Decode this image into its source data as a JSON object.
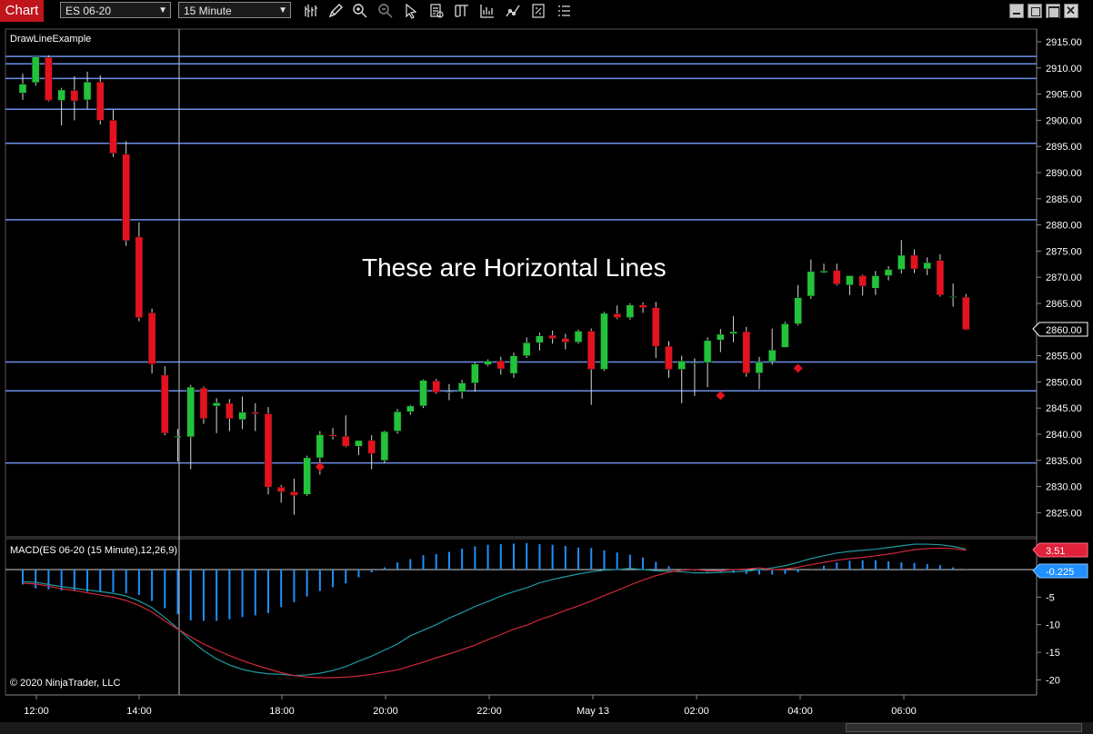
{
  "app": {
    "title": "Chart"
  },
  "toolbar": {
    "instrument": "ES 06-20",
    "interval": "15 Minute",
    "icons": [
      "bar-style-icon",
      "drawing-tools-icon",
      "zoom-in-icon",
      "zoom-out-icon",
      "pointer-icon",
      "data-box-icon",
      "properties-icon",
      "indicators-icon",
      "strategies-icon",
      "templates-icon",
      "chart-trader-icon"
    ]
  },
  "window_controls": [
    "minimize-icon",
    "restore-icon",
    "maximize-icon",
    "close-icon"
  ],
  "price_panel": {
    "label": "DrawLineExample",
    "annotation": "These are Horizontal Lines",
    "current_price": "2860.00",
    "axis_ticks": [
      "2915.00",
      "2910.00",
      "2905.00",
      "2900.00",
      "2895.00",
      "2890.00",
      "2885.00",
      "2880.00",
      "2875.00",
      "2870.00",
      "2865.00",
      "2860.00",
      "2855.00",
      "2850.00",
      "2845.00",
      "2840.00",
      "2835.00",
      "2830.00",
      "2825.00"
    ],
    "horizontal_lines": [
      2912.2,
      2910.8,
      2908.0,
      2902.1,
      2895.6,
      2881.0,
      2853.8,
      2848.3,
      2834.5
    ],
    "line_color": "#6b8fe8"
  },
  "macd_panel": {
    "label": "MACD(ES 06-20 (15 Minute),12,26,9)",
    "macd_value": "3.51",
    "signal_value": "-0.225",
    "axis_ticks": [
      "-5",
      "-10",
      "-15",
      "-20"
    ],
    "copyright": "© 2020 NinjaTrader, LLC",
    "colors": {
      "macd": "#d0283a",
      "avg": "#1f9aa0",
      "hist": "#1e90ff"
    }
  },
  "time_axis": [
    "12:00",
    "14:00",
    "18:00",
    "20:00",
    "22:00",
    "May 13",
    "02:00",
    "04:00",
    "06:00"
  ],
  "chart_data": {
    "type": "candlestick",
    "up_color": "#22c33a",
    "down_color": "#e3121e",
    "candles": [
      [
        2905.2,
        2908.9,
        2903.9,
        2906.9
      ],
      [
        2907.2,
        2912.0,
        2906.6,
        2912.1
      ],
      [
        2912.0,
        2912.4,
        2903.6,
        2903.8
      ],
      [
        2903.8,
        2906.2,
        2899.0,
        2905.8
      ],
      [
        2905.7,
        2908.4,
        2900.0,
        2903.7
      ],
      [
        2903.9,
        2909.3,
        2902.2,
        2907.3
      ],
      [
        2907.3,
        2908.6,
        2899.2,
        2900.0
      ],
      [
        2900.0,
        2902.0,
        2893.0,
        2893.7
      ],
      [
        2893.5,
        2896.0,
        2876.0,
        2877.0
      ],
      [
        2877.7,
        2880.5,
        2861.6,
        2862.3
      ],
      [
        2863.2,
        2864.0,
        2851.6,
        2853.4
      ],
      [
        2851.3,
        2853.0,
        2839.8,
        2840.2
      ],
      [
        2839.4,
        2841.0,
        2834.8,
        2839.6
      ],
      [
        2839.5,
        2849.4,
        2833.3,
        2849.0
      ],
      [
        2848.8,
        2849.1,
        2842.0,
        2843.0
      ],
      [
        2845.4,
        2846.9,
        2840.2,
        2846.0
      ],
      [
        2845.9,
        2846.7,
        2840.6,
        2843.0
      ],
      [
        2842.8,
        2847.2,
        2841.0,
        2844.2
      ],
      [
        2844.2,
        2845.9,
        2840.6,
        2843.9
      ],
      [
        2843.9,
        2845.2,
        2828.5,
        2829.9
      ],
      [
        2829.9,
        2830.3,
        2826.9,
        2829.0
      ],
      [
        2829.0,
        2831.5,
        2824.6,
        2828.3
      ],
      [
        2828.5,
        2835.9,
        2828.2,
        2835.5
      ],
      [
        2835.5,
        2840.6,
        2832.3,
        2839.9
      ],
      [
        2839.9,
        2841.2,
        2839.0,
        2839.6
      ],
      [
        2839.6,
        2843.6,
        2837.5,
        2837.7
      ],
      [
        2837.7,
        2838.8,
        2836.0,
        2838.8
      ],
      [
        2838.8,
        2839.8,
        2833.3,
        2836.3
      ],
      [
        2835.0,
        2840.7,
        2834.5,
        2840.5
      ],
      [
        2840.6,
        2844.8,
        2840.1,
        2844.3
      ],
      [
        2844.3,
        2845.6,
        2843.7,
        2845.4
      ],
      [
        2845.4,
        2850.5,
        2845.0,
        2850.3
      ],
      [
        2850.2,
        2850.6,
        2847.7,
        2848.0
      ],
      [
        2848.0,
        2849.6,
        2846.5,
        2848.1
      ],
      [
        2848.1,
        2850.4,
        2846.8,
        2849.8
      ],
      [
        2849.8,
        2853.7,
        2848.1,
        2853.4
      ],
      [
        2853.3,
        2854.3,
        2853.0,
        2854.0
      ],
      [
        2854.0,
        2854.8,
        2851.4,
        2852.5
      ],
      [
        2851.6,
        2855.6,
        2850.8,
        2855.0
      ],
      [
        2855.0,
        2858.5,
        2854.6,
        2857.5
      ],
      [
        2857.5,
        2859.4,
        2856.0,
        2858.8
      ],
      [
        2858.9,
        2859.8,
        2857.3,
        2858.3
      ],
      [
        2858.3,
        2859.2,
        2856.2,
        2857.6
      ],
      [
        2857.6,
        2860.0,
        2857.3,
        2859.7
      ],
      [
        2859.7,
        2860.2,
        2845.6,
        2852.4
      ],
      [
        2852.4,
        2863.4,
        2852.1,
        2863.1
      ],
      [
        2863.0,
        2864.6,
        2862.0,
        2862.3
      ],
      [
        2862.3,
        2865.0,
        2861.9,
        2864.7
      ],
      [
        2864.7,
        2865.2,
        2863.2,
        2864.2
      ],
      [
        2864.2,
        2865.3,
        2854.6,
        2856.8
      ],
      [
        2856.8,
        2857.8,
        2850.8,
        2852.4
      ],
      [
        2852.4,
        2855.0,
        2845.9,
        2854.0
      ],
      [
        2853.6,
        2854.5,
        2847.3,
        2853.7
      ],
      [
        2853.7,
        2858.5,
        2849.0,
        2857.9
      ],
      [
        2858.0,
        2860.1,
        2855.7,
        2859.1
      ],
      [
        2859.2,
        2862.6,
        2857.6,
        2859.6
      ],
      [
        2859.6,
        2860.5,
        2851.0,
        2851.7
      ],
      [
        2851.7,
        2854.8,
        2848.6,
        2853.8
      ],
      [
        2853.9,
        2860.2,
        2853.3,
        2856.1
      ],
      [
        2856.6,
        2861.5,
        2856.6,
        2861.1
      ],
      [
        2861.1,
        2868.5,
        2860.8,
        2866.1
      ],
      [
        2866.4,
        2873.4,
        2865.9,
        2871.1
      ],
      [
        2870.9,
        2872.6,
        2870.8,
        2871.2
      ],
      [
        2871.3,
        2872.6,
        2868.4,
        2868.7
      ],
      [
        2868.5,
        2870.3,
        2866.6,
        2870.3
      ],
      [
        2870.3,
        2870.5,
        2866.5,
        2868.3
      ],
      [
        2867.9,
        2871.2,
        2866.6,
        2870.3
      ],
      [
        2870.3,
        2872.1,
        2869.4,
        2871.5
      ],
      [
        2871.5,
        2877.1,
        2870.7,
        2874.2
      ],
      [
        2874.2,
        2875.3,
        2870.8,
        2871.6
      ],
      [
        2871.6,
        2873.8,
        2870.4,
        2872.8
      ],
      [
        2873.2,
        2874.4,
        2866.3,
        2866.6
      ],
      [
        2866.3,
        2868.8,
        2864.4,
        2866.3
      ],
      [
        2866.2,
        2866.8,
        2859.9,
        2860.0
      ]
    ],
    "markers": [
      [
        23,
        2833.8
      ],
      [
        54,
        2847.4
      ],
      [
        60,
        2852.6
      ]
    ],
    "macd": [
      -2.5,
      -2.6,
      -3.0,
      -3.5,
      -3.8,
      -4.2,
      -4.6,
      -5.0,
      -5.6,
      -6.5,
      -7.7,
      -9.3,
      -10.8,
      -12.2,
      -13.5,
      -14.6,
      -15.6,
      -16.5,
      -17.3,
      -18.0,
      -18.7,
      -19.2,
      -19.5,
      -19.6,
      -19.6,
      -19.5,
      -19.3,
      -19.0,
      -18.6,
      -18.2,
      -17.5,
      -16.8,
      -16.0,
      -15.3,
      -14.5,
      -13.7,
      -12.7,
      -11.8,
      -10.8,
      -10.1,
      -9.1,
      -8.3,
      -7.4,
      -6.6,
      -5.7,
      -4.7,
      -3.8,
      -2.8,
      -1.9,
      -1.1,
      -0.5,
      -0.1,
      0.0,
      -0.2,
      -0.2,
      0.0,
      0.1,
      0.3,
      0.0,
      0.1,
      0.4,
      0.9,
      1.3,
      1.7,
      2.0,
      2.2,
      2.5,
      2.8,
      3.2,
      3.6,
      3.8,
      3.9,
      3.8,
      3.5
    ],
    "avg": [
      -2.2,
      -2.3,
      -2.7,
      -3.1,
      -3.4,
      -3.7,
      -4.0,
      -4.3,
      -4.8,
      -5.7,
      -6.9,
      -8.7,
      -10.7,
      -12.8,
      -14.7,
      -16.2,
      -17.3,
      -18.1,
      -18.6,
      -18.9,
      -19.0,
      -19.2,
      -19.1,
      -18.8,
      -18.3,
      -17.6,
      -16.6,
      -15.7,
      -14.6,
      -13.5,
      -12.0,
      -11.0,
      -10.0,
      -8.8,
      -7.8,
      -6.7,
      -5.8,
      -4.8,
      -4.0,
      -3.3,
      -2.4,
      -1.8,
      -1.3,
      -0.8,
      -0.4,
      -0.1,
      0.0,
      0.2,
      0.0,
      -0.2,
      -0.3,
      -0.4,
      -0.6,
      -0.6,
      -0.5,
      -0.4,
      -0.3,
      0.0,
      0.3,
      0.7,
      1.3,
      2.0,
      2.5,
      3.0,
      3.3,
      3.5,
      3.7,
      4.0,
      4.3,
      4.6,
      4.6,
      4.5,
      4.2,
      3.7
    ],
    "hist": [
      -2.7,
      -3.4,
      -3.6,
      -3.8,
      -3.9,
      -4.0,
      -4.0,
      -4.1,
      -4.3,
      -4.6,
      -5.7,
      -7.0,
      -8.1,
      -9.2,
      -9.3,
      -9.3,
      -9.0,
      -8.6,
      -8.3,
      -7.9,
      -6.8,
      -5.9,
      -4.9,
      -3.9,
      -3.2,
      -2.5,
      -1.4,
      -0.5,
      0.4,
      1.3,
      1.9,
      2.6,
      2.8,
      3.2,
      3.8,
      4.2,
      4.5,
      4.6,
      4.7,
      4.8,
      4.6,
      4.5,
      4.3,
      4.0,
      3.9,
      3.5,
      3.1,
      2.7,
      2.2,
      1.4,
      0.6,
      0.1,
      -0.2,
      -0.4,
      -0.6,
      -0.6,
      -0.8,
      -0.9,
      -0.9,
      -0.8,
      -0.5,
      0.1,
      0.7,
      1.3,
      1.6,
      1.7,
      1.7,
      1.5,
      1.3,
      1.2,
      1.0,
      0.8,
      0.4,
      0.1
    ]
  }
}
